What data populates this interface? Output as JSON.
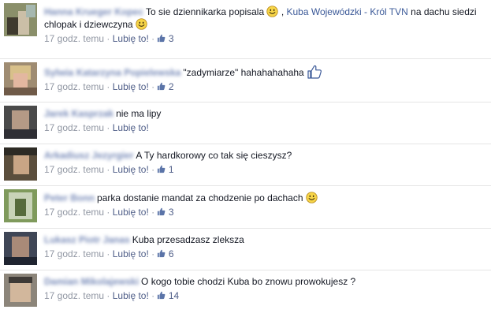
{
  "colors": {
    "author": "#4a63a0",
    "link": "#3b5998",
    "meta": "#9197a3",
    "like": "#4e5d87",
    "divider": "#e5e5e5"
  },
  "icons": {
    "smiley": "smiley-icon",
    "like": "thumbs-up-icon"
  },
  "comments": [
    {
      "author": "Hanna Krueger Kopec",
      "text_1": "To sie dziennikarka popisala",
      "link_1": "Kuba Wojewódzki - Król TVN",
      "text_2": "na dachu siedzi chlopak i dziewczyna",
      "time": "17 godz. temu",
      "like": "Lubię to!",
      "sep": "·",
      "likes": "3"
    },
    {
      "author": "Sylwia Katarzyna Popielewska",
      "text": "\"zadymiarze\" hahahahahaha",
      "time": "17 godz. temu",
      "like": "Lubię to!",
      "sep": "·",
      "likes": "2"
    },
    {
      "author": "Jarek Kasprzak",
      "text": "nie ma lipy",
      "time": "17 godz. temu",
      "like": "Lubię to!",
      "sep": "·"
    },
    {
      "author": "Arkadiusz Jezyrgier",
      "text": "A Ty hardkorowy co tak się cieszysz?",
      "time": "17 godz. temu",
      "like": "Lubię to!",
      "sep": "·",
      "likes": "1"
    },
    {
      "author": "Peter Bonn",
      "text": "parka dostanie mandat za chodzenie po dachach",
      "time": "17 godz. temu",
      "like": "Lubię to!",
      "sep": "·",
      "likes": "3"
    },
    {
      "author": "Lukasz Piotr Janas",
      "text": "Kuba przesadzasz zleksza",
      "time": "17 godz. temu",
      "like": "Lubię to!",
      "sep": "·",
      "likes": "6"
    },
    {
      "author": "Damian Mikolajewski",
      "text": "O kogo tobie chodzi Kuba bo znowu prowokujesz ?",
      "time": "17 godz. temu",
      "like": "Lubię to!",
      "sep": "·",
      "likes": "14"
    }
  ]
}
